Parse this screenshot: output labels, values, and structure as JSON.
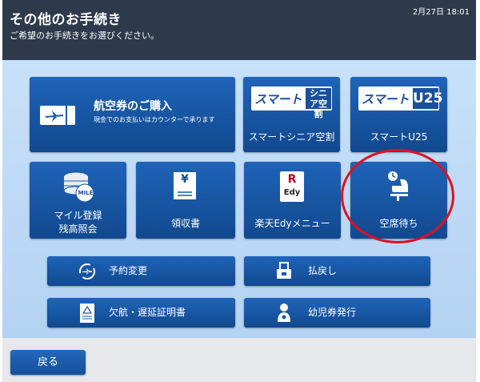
{
  "header": {
    "title": "その他のお手続き",
    "subtitle": "ご希望のお手続きをお選びください。",
    "datetime": "2月27日 18:01"
  },
  "tiles": {
    "purchase": {
      "title": "航空券のご購入",
      "desc": "現金でのお支払いはカウンターで承ります",
      "icon": "ticket-plane-icon"
    },
    "smart_senior": {
      "badge_main": "スマート",
      "badge_side": "シニア空割",
      "label": "スマートシニア空割"
    },
    "smart_u25": {
      "badge_main": "スマート",
      "badge_side": "U25",
      "label": "スマートU25"
    },
    "mileage": {
      "label_line1": "マイル登録",
      "label_line2": "残高照会",
      "coin_text": "MILE",
      "icon": "coins-icon"
    },
    "receipt": {
      "label": "領収書",
      "icon_symbol": "¥",
      "icon": "receipt-icon"
    },
    "edy": {
      "label": "楽天Edyメニュー",
      "logo_r": "R",
      "logo_text": "Edy"
    },
    "standby": {
      "label": "空席待ち",
      "icon": "seat-clock-icon"
    }
  },
  "actions": {
    "change": {
      "label": "予約変更",
      "icon": "plane-cycle-icon"
    },
    "refund": {
      "label": "払戻し",
      "icon": "refund-icon"
    },
    "cert": {
      "label": "欠航・遅延証明書",
      "icon": "certificate-icon"
    },
    "infant": {
      "label": "幼児券発行",
      "icon": "infant-icon"
    }
  },
  "footer": {
    "back_label": "戻る"
  },
  "colors": {
    "header": "#2e3a4b",
    "tile": "#1a5aab",
    "panel": "#c0dbf6",
    "highlight_ring": "#e01020"
  }
}
